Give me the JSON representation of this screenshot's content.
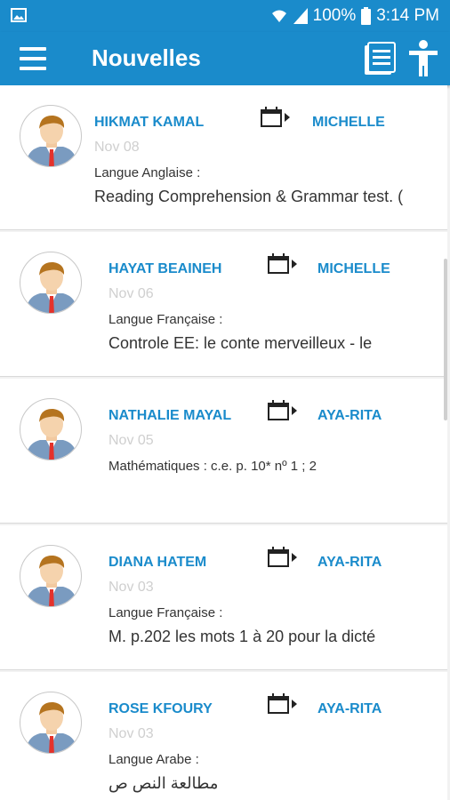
{
  "status": {
    "battery": "100%",
    "time": "3:14 PM"
  },
  "header": {
    "title": "Nouvelles"
  },
  "items": [
    {
      "sender": "HIKMAT KAMAL",
      "recipient": "MICHELLE",
      "date": "Nov 08",
      "subject": "Langue Anglaise :",
      "body": "Reading Comprehension & Grammar test. ("
    },
    {
      "sender": "HAYAT BEAINEH",
      "recipient": "MICHELLE",
      "date": "Nov 06",
      "subject": "Langue Française :",
      "body": "Controle EE: le conte merveilleux - le"
    },
    {
      "sender": "NATHALIE MAYAL",
      "recipient": "AYA-RITA",
      "date": "Nov 05",
      "subject": "Mathématiques : c.e. p. 10* nº 1 ; 2",
      "body": ""
    },
    {
      "sender": "DIANA HATEM",
      "recipient": "AYA-RITA",
      "date": "Nov 03",
      "subject": "Langue Française :",
      "body": "M. p.202 les mots 1 à 20 pour la dicté"
    },
    {
      "sender": "ROSE KFOURY",
      "recipient": "AYA-RITA",
      "date": "Nov 03",
      "subject": "Langue Arabe :",
      "body": "مطالعة النص ص"
    }
  ],
  "colors": {
    "primary": "#1a8bcb",
    "date": "#cfcfcf",
    "tie": "#e4322b"
  },
  "icons": [
    "gallery-icon",
    "wifi-icon",
    "signal-icon",
    "battery-icon",
    "menu-icon",
    "list-icon",
    "person-icon",
    "calendar-icon",
    "avatar-icon"
  ]
}
